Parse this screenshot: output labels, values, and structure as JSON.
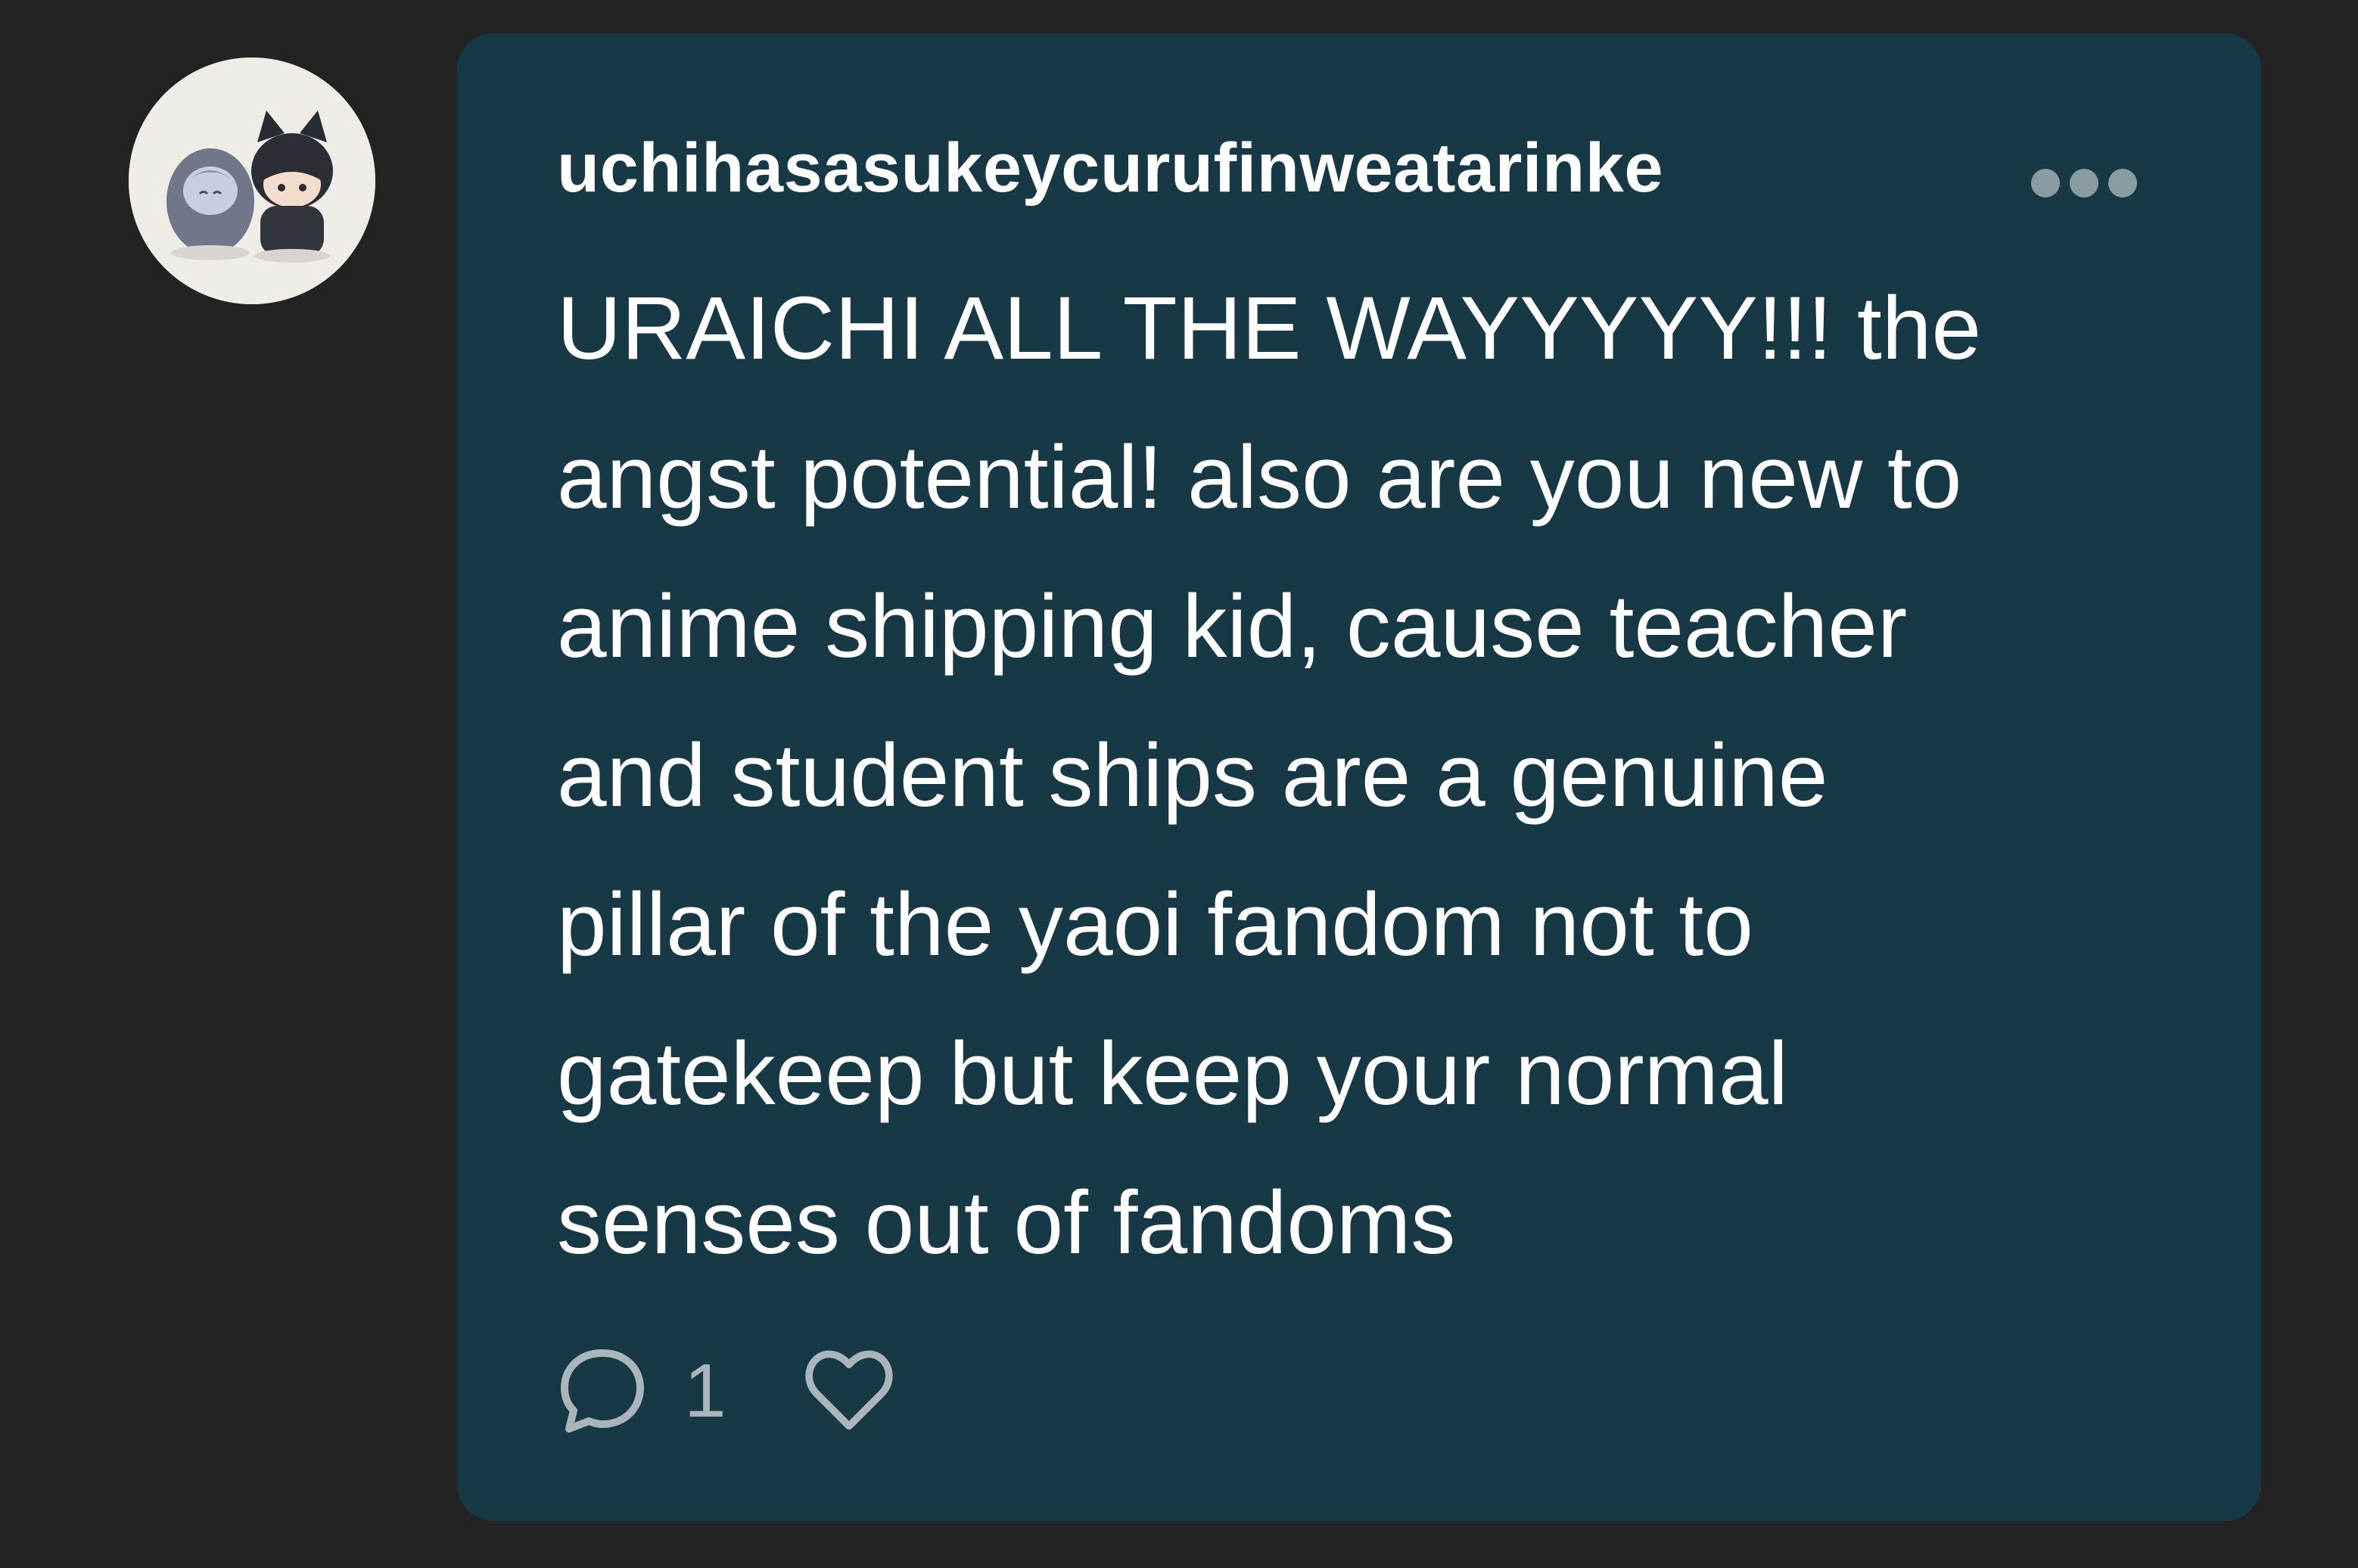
{
  "comment": {
    "username": "uchihasasukeycurufinweatarinke",
    "message_lines": [
      "URAICHI ALL THE WAYYYYY!!! the",
      "angst potential! also are you new to",
      "anime shipping kid, cause teacher",
      "and student ships are a genuine",
      "pillar of the yaoi fandom not to",
      "gatekeep but keep your normal",
      "senses out of fandoms"
    ],
    "reply_count": "1",
    "icons": {
      "avatar": "avatar-figurines",
      "more": "more-options-icon",
      "reply": "speech-bubble-icon",
      "like": "heart-icon"
    }
  },
  "colors": {
    "page_background": "#232323",
    "bubble_background": "#173845",
    "text": "#ffffff",
    "muted": "#a9b5ba"
  }
}
